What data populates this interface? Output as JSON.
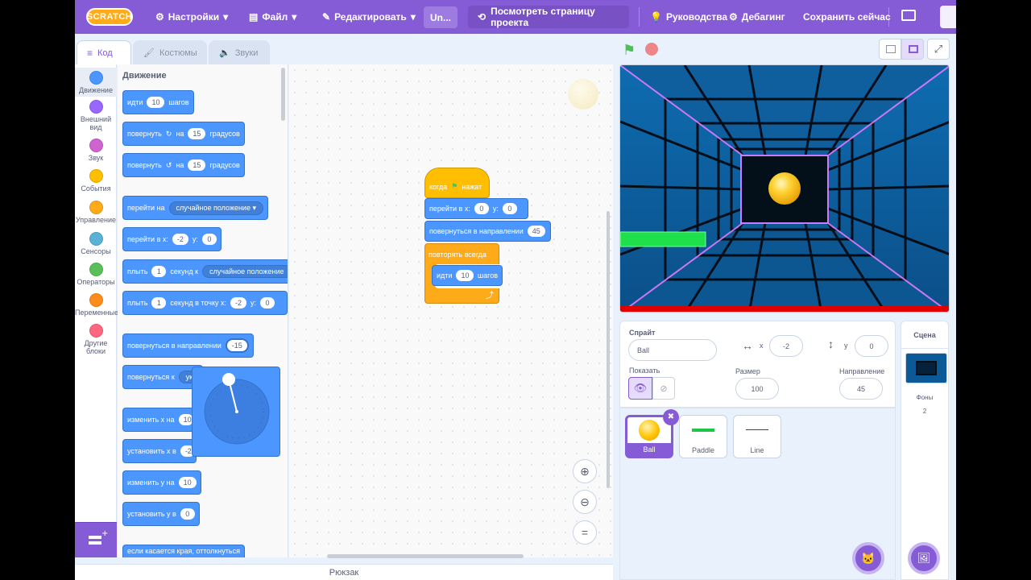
{
  "menu": {
    "logo": "SCRATCH",
    "settings": "Настройки",
    "file": "Файл",
    "edit": "Редактировать",
    "project_title": "Un...",
    "see_project": "Посмотреть страницу проекта",
    "tutorials": "Руководства",
    "debugging": "Дебагинг",
    "save_now": "Сохранить сейчас"
  },
  "tabs": {
    "code": "Код",
    "costumes": "Костюмы",
    "sounds": "Звуки"
  },
  "categories": [
    {
      "label": "Движение",
      "color": "#4c97ff"
    },
    {
      "label": "Внешний вид",
      "color": "#9966ff"
    },
    {
      "label": "Звук",
      "color": "#cf63cf"
    },
    {
      "label": "События",
      "color": "#ffbf00"
    },
    {
      "label": "Управление",
      "color": "#ffab19"
    },
    {
      "label": "Сенсоры",
      "color": "#5cb1d6"
    },
    {
      "label": "Операторы",
      "color": "#59c059"
    },
    {
      "label": "Переменные",
      "color": "#ff8c1a"
    },
    {
      "label": "Другие блоки",
      "color": "#ff6680"
    }
  ],
  "palette": {
    "heading": "Движение",
    "move": {
      "a": "идти",
      "v": "10",
      "b": "шагов"
    },
    "turn_right": {
      "a": "повернуть",
      "b": "на",
      "v": "15",
      "c": "градусов"
    },
    "turn_left": {
      "a": "повернуть",
      "b": "на",
      "v": "15",
      "c": "градусов"
    },
    "goto": {
      "a": "перейти на",
      "dd": "случайное положение"
    },
    "goto_xy": {
      "a": "перейти в x:",
      "x": "-2",
      "b": "y:",
      "y": "0"
    },
    "glide": {
      "a": "плыть",
      "v": "1",
      "b": "секунд к",
      "dd": "случайное положение"
    },
    "glide_xy": {
      "a": "плыть",
      "v": "1",
      "b": "секунд в точку x:",
      "x": "-2",
      "c": "y:",
      "y": "0"
    },
    "point_dir": {
      "a": "повернуться в направлении",
      "v": "-15"
    },
    "point_towards": {
      "a": "повернуться к",
      "dd": "ук"
    },
    "change_x": {
      "a": "изменить х на",
      "v": "10"
    },
    "set_x": {
      "a": "установить х в",
      "v": "-2"
    },
    "change_y": {
      "a": "изменить у на",
      "v": "10"
    },
    "set_y": {
      "a": "установить у в",
      "v": "0"
    },
    "bounce": {
      "a": "если касается края, оттолкнуться"
    }
  },
  "script": {
    "hat": {
      "a": "когда",
      "b": "нажат"
    },
    "goto_xy": {
      "a": "перейти в x:",
      "x": "0",
      "b": "y:",
      "y": "0"
    },
    "point": {
      "a": "повернуться в направлении",
      "v": "45"
    },
    "forever": {
      "a": "повторять всегда"
    },
    "move": {
      "a": "идти",
      "v": "10",
      "b": "шагов"
    }
  },
  "backpack": "Рюкзак",
  "sprite_info": {
    "sprite_label": "Спрайт",
    "sprite_name": "Ball",
    "x_label": "x",
    "x": "-2",
    "y_label": "y",
    "y": "0",
    "show_label": "Показать",
    "size_label": "Размер",
    "size": "100",
    "direction_label": "Направление",
    "direction": "45"
  },
  "sprites": [
    {
      "name": "Ball"
    },
    {
      "name": "Paddle"
    },
    {
      "name": "Line"
    }
  ],
  "scene": {
    "label": "Сцена",
    "backdrops_label": "Фоны",
    "backdrops_count": "2"
  }
}
